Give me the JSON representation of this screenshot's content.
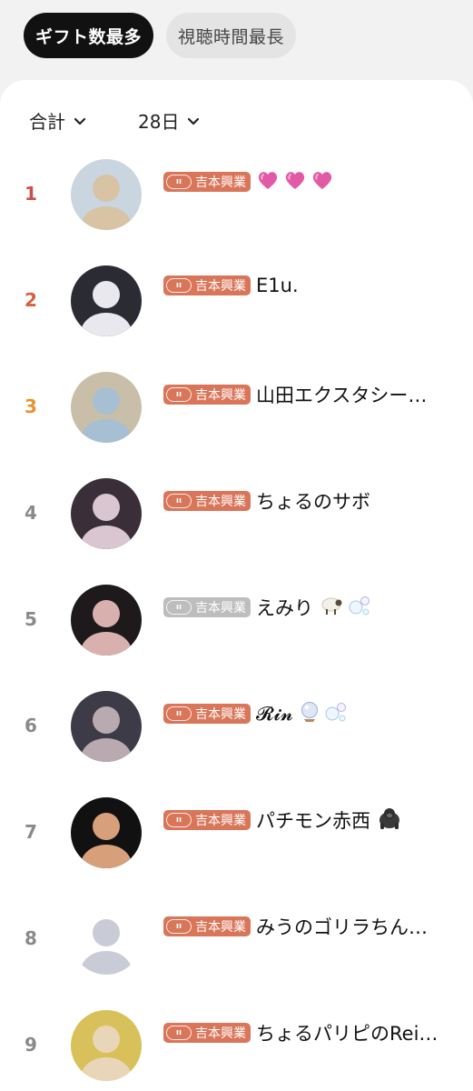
{
  "tabs": {
    "gift": "ギフト数最多",
    "watch": "視聴時間最長"
  },
  "filters": {
    "type": "合計",
    "period": "28日"
  },
  "colors": {
    "rank1": "#c9504f",
    "rank2": "#d5603f",
    "rank3": "#e59431",
    "rank_other": "#8a8a8a",
    "badge_active": "#d9765a",
    "badge_inactive": "#bdbdbd"
  },
  "ranking": [
    {
      "rank": "1",
      "agency": "吉本興業",
      "name": "",
      "suffix_icons": [
        "pink-heart-icon",
        "pink-heart-icon",
        "pink-heart-icon"
      ],
      "badge": "orange"
    },
    {
      "rank": "2",
      "agency": "吉本興業",
      "name": "E1u.",
      "suffix_icons": [],
      "badge": "orange"
    },
    {
      "rank": "3",
      "agency": "吉本興業",
      "name": "山田エクスタシー…",
      "suffix_icons": [],
      "badge": "orange"
    },
    {
      "rank": "4",
      "agency": "吉本興業",
      "name": "ちょるのサボ",
      "suffix_icons": [],
      "badge": "orange"
    },
    {
      "rank": "5",
      "agency": "吉本興業",
      "name": "えみり",
      "suffix_icons": [
        "sheep-icon",
        "bubbles-icon"
      ],
      "badge": "gray"
    },
    {
      "rank": "6",
      "agency": "吉本興業",
      "name": "𝓡𝓲𝓷",
      "suffix_icons": [
        "crystal-ball-icon",
        "bubbles-icon"
      ],
      "badge": "orange"
    },
    {
      "rank": "7",
      "agency": "吉本興業",
      "name": "パチモン赤西",
      "suffix_icons": [
        "gorilla-icon"
      ],
      "badge": "orange"
    },
    {
      "rank": "8",
      "agency": "吉本興業",
      "name": "みうのゴリラちん…",
      "suffix_icons": [],
      "badge": "orange"
    },
    {
      "rank": "9",
      "agency": "吉本興業",
      "name": "ちょるパリピのRei…",
      "suffix_icons": [],
      "badge": "orange"
    }
  ]
}
